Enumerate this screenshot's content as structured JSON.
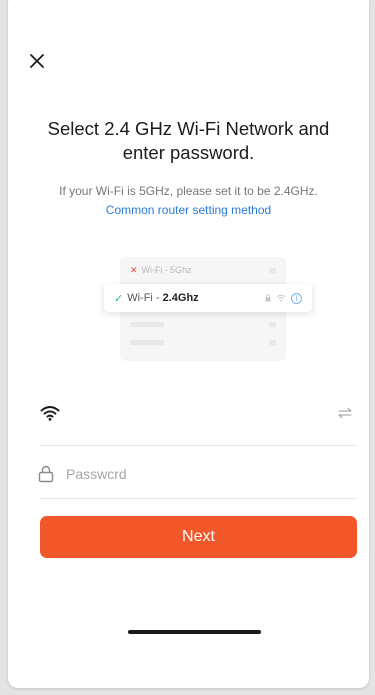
{
  "header": {
    "close_icon": "close-icon"
  },
  "content": {
    "title": "Select 2.4 GHz Wi-Fi Network and enter password.",
    "subtitle": "If your Wi-Fi is 5GHz, please set it to be 2.4GHz.",
    "router_link": "Common router setting method"
  },
  "illustration": {
    "bad_prefix": "Wi-Fi - ",
    "bad_band": "5Ghz",
    "good_prefix": "Wi-Fi - ",
    "good_band": "2.4Ghz",
    "info_glyph": "i"
  },
  "form": {
    "wifi": {
      "value": "",
      "placeholder": "",
      "icon": "wifi-icon",
      "switch_icon": "switch-network-icon"
    },
    "password": {
      "value": "",
      "placeholder": "Passwcrd",
      "icon": "lock-icon"
    },
    "next_label": "Next"
  },
  "colors": {
    "accent": "#f2572a",
    "link": "#2a7bd8",
    "success": "#3bb273",
    "error": "#e34a40"
  }
}
